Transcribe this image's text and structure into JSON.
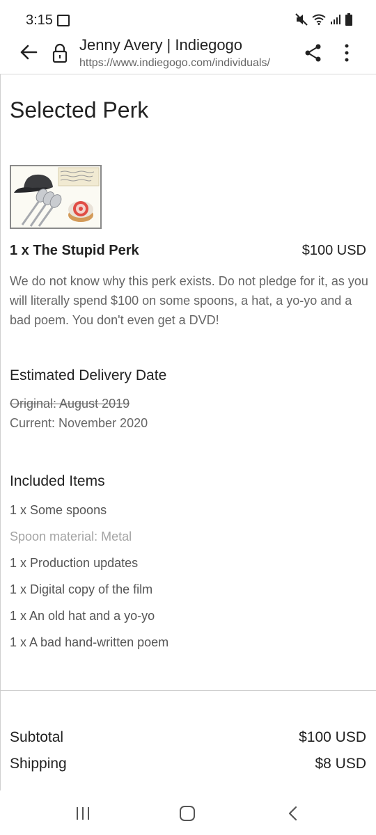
{
  "status": {
    "time": "3:15"
  },
  "browser": {
    "title": "Jenny Avery | Indiegogo",
    "url": "https://www.indiegogo.com/individuals/"
  },
  "page": {
    "heading": "Selected Perk",
    "perk": {
      "name": "1 x The Stupid Perk",
      "price": "$100 USD",
      "description": "We do not know why this perk exists. Do not pledge for it, as you will literally spend $100 on some spoons, a hat, a yo-yo and a bad poem. You don't even get a DVD!"
    },
    "delivery": {
      "heading": "Estimated Delivery Date",
      "original": "Original: August 2019",
      "current": "Current: November 2020"
    },
    "included": {
      "heading": "Included Items",
      "items": [
        "1 x Some spoons",
        "Spoon material: Metal",
        "1 x Production updates",
        "1 x Digital copy of the film",
        "1 x An old hat and a yo-yo",
        "1 x A bad hand-written poem"
      ]
    },
    "summary": {
      "subtotal_label": "Subtotal",
      "subtotal_value": "$100 USD",
      "shipping_label": "Shipping",
      "shipping_value": "$8 USD"
    }
  },
  "icons": {
    "back": "arrow-left-icon",
    "lock": "lock-icon",
    "share": "share-icon",
    "menu": "more-vert-icon"
  }
}
